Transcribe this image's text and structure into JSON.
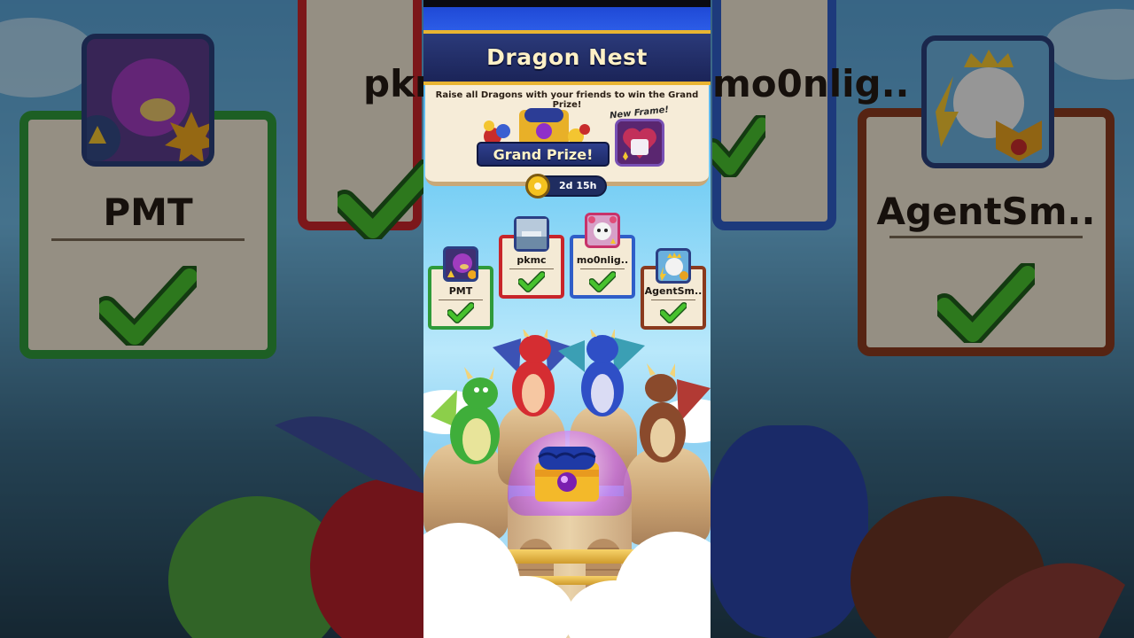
{
  "game": {
    "title": "Dragon Nest",
    "subtitle": "Raise all Dragons with your friends to win the Grand Prize!",
    "grand_prize_label": "Grand Prize!",
    "new_frame_label": "New Frame!",
    "timer": "2d 15h"
  },
  "players": [
    {
      "name": "PMT",
      "status": "complete",
      "frame_color": "#2f9a3a"
    },
    {
      "name": "pkmc",
      "status": "complete",
      "frame_color": "#c8252a"
    },
    {
      "name": "mo0nlig..",
      "status": "complete",
      "frame_color": "#2f5ec8"
    },
    {
      "name": "AgentSm..",
      "status": "complete",
      "frame_color": "#8a3a1e"
    }
  ],
  "background_names": [
    "PMT",
    "pkmc",
    "mo0nlig..",
    "AgentSm.."
  ],
  "dragons": [
    "green-dragon",
    "red-dragon",
    "blue-dragon",
    "brown-dragon"
  ],
  "colors": {
    "banner": "#1b2458",
    "banner_trim": "#e9b431",
    "panel": "#f6ecd8",
    "check": "#3db427"
  }
}
